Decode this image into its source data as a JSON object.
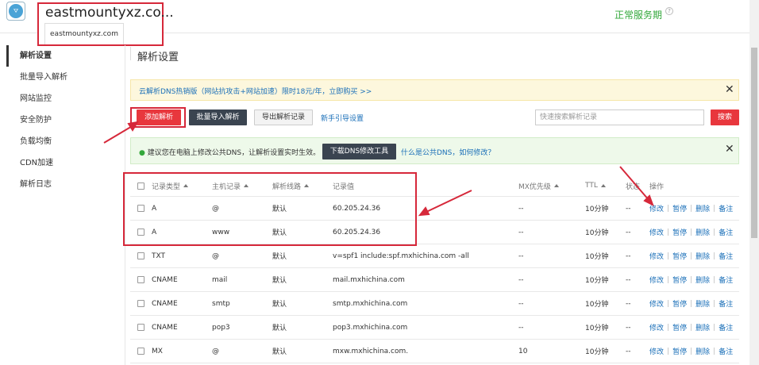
{
  "header": {
    "logo_text": "ᗊ",
    "domain_title": "eastmountyxz.co...",
    "domain_tab": "eastmountyxz.com",
    "service_status": "正常服务期",
    "help_glyph": "?"
  },
  "sidebar": {
    "items": [
      {
        "label": "解析设置"
      },
      {
        "label": "批量导入解析"
      },
      {
        "label": "网站监控"
      },
      {
        "label": "安全防护"
      },
      {
        "label": "负载均衡"
      },
      {
        "label": "CDN加速"
      },
      {
        "label": "解析日志"
      }
    ]
  },
  "main": {
    "title": "解析设置",
    "promo_text": "云解析DNS热销版（网站抗攻击+网站加速）限时18元/年，立即购买 >>",
    "close_glyph": "✕",
    "toolbar": {
      "add_label": "添加解析",
      "import_label": "批量导入解析",
      "export_label": "导出解析记录",
      "guide_label": "新手引导设置",
      "search_placeholder": "快速搜索解析记录",
      "search_label": "搜索"
    },
    "tip": {
      "text": "建议您在电脑上修改公共DNS，让解析设置实时生效。",
      "button_label": "下载DNS修改工具",
      "link_label": "什么是公共DNS，如何修改？"
    }
  },
  "table": {
    "headers": {
      "type": "记录类型",
      "host": "主机记录",
      "line": "解析线路",
      "value": "记录值",
      "mx": "MX优先级",
      "ttl": "TTL",
      "status": "状态",
      "ops": "操作"
    },
    "op_labels": {
      "edit": "修改",
      "pause": "暂停",
      "delete": "删除",
      "note": "备注"
    },
    "rows": [
      {
        "type": "A",
        "host": "@",
        "line": "默认",
        "value": "60.205.24.36",
        "mx": "--",
        "ttl": "10分钟",
        "status": "--"
      },
      {
        "type": "A",
        "host": "www",
        "line": "默认",
        "value": "60.205.24.36",
        "mx": "--",
        "ttl": "10分钟",
        "status": "--"
      },
      {
        "type": "TXT",
        "host": "@",
        "line": "默认",
        "value": "v=spf1 include:spf.mxhichina.com -all",
        "mx": "--",
        "ttl": "10分钟",
        "status": "--"
      },
      {
        "type": "CNAME",
        "host": "mail",
        "line": "默认",
        "value": "mail.mxhichina.com",
        "mx": "--",
        "ttl": "10分钟",
        "status": "--"
      },
      {
        "type": "CNAME",
        "host": "smtp",
        "line": "默认",
        "value": "smtp.mxhichina.com",
        "mx": "--",
        "ttl": "10分钟",
        "status": "--"
      },
      {
        "type": "CNAME",
        "host": "pop3",
        "line": "默认",
        "value": "pop3.mxhichina.com",
        "mx": "--",
        "ttl": "10分钟",
        "status": "--"
      },
      {
        "type": "MX",
        "host": "@",
        "line": "默认",
        "value": "mxw.mxhichina.com.",
        "mx": "10",
        "ttl": "10分钟",
        "status": "--"
      }
    ]
  },
  "colors": {
    "annotation_red": "#d6283a",
    "primary_red": "#e8373d",
    "link_blue": "#1a6fb8",
    "status_green": "#33a83b"
  }
}
